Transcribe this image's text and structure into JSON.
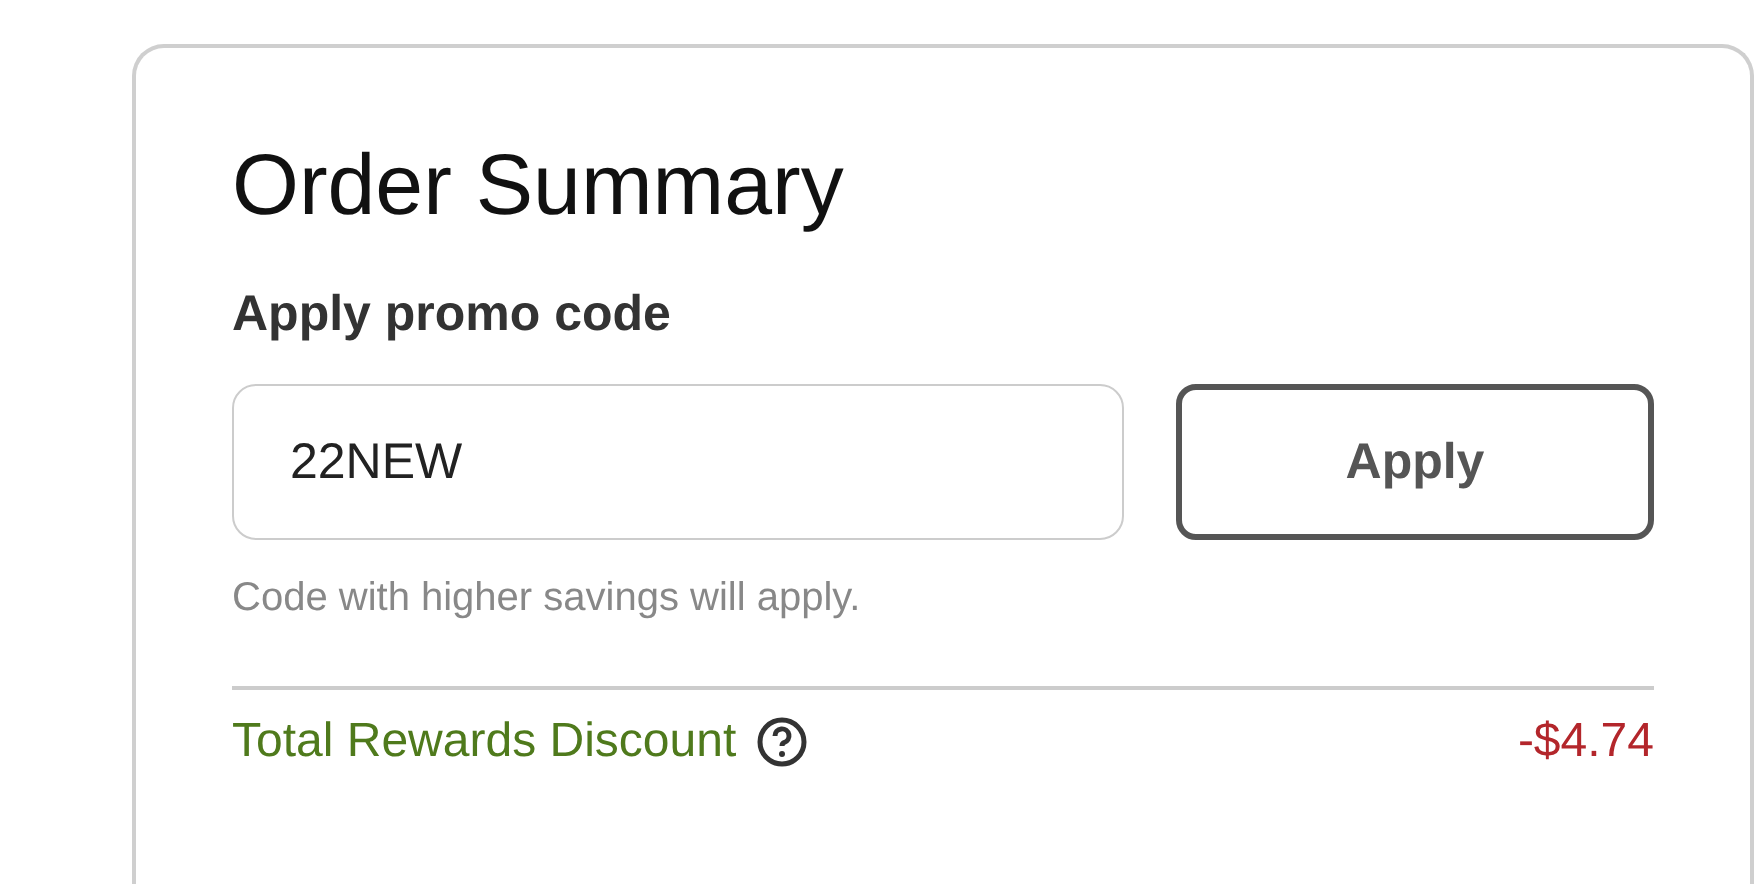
{
  "card": {
    "title": "Order Summary",
    "promo": {
      "label": "Apply promo code",
      "value": "22NEW",
      "button": "Apply",
      "hint": "Code with higher savings will apply."
    },
    "lines": [
      {
        "label": "Total Rewards Discount",
        "amount": "-$4.74",
        "kind": "discount"
      }
    ]
  }
}
